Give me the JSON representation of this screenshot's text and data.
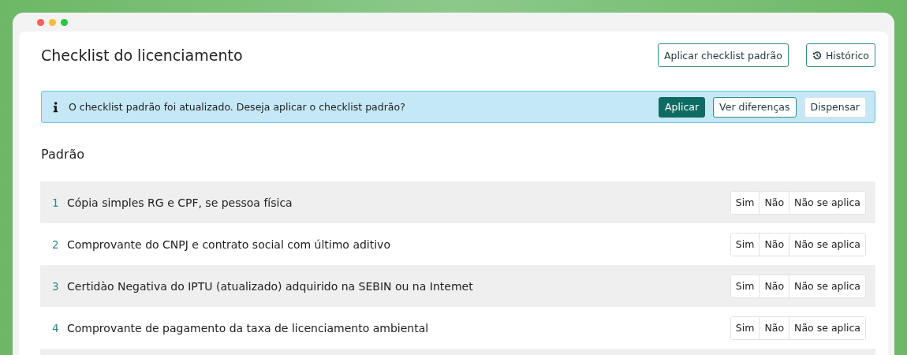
{
  "page": {
    "title": "Checklist do licenciamento",
    "actions": [
      {
        "label": "Aplicar checklist padrão",
        "kind": "text"
      },
      {
        "label": "Histórico",
        "kind": "history"
      }
    ]
  },
  "alert": {
    "message": "O checklist padrão foi atualizado. Deseja aplicar o checklist padrão?",
    "buttons": [
      {
        "label": "Aplicar",
        "kind": "primary"
      },
      {
        "label": "Ver diferenças",
        "kind": "outline"
      },
      {
        "label": "Dispensar",
        "kind": "plain"
      }
    ]
  },
  "section": {
    "title": "Padrão",
    "items": [
      {
        "number": "1",
        "text": "Cópia simples RG e CPF, se pessoa física",
        "options": [
          {
            "label": "Sim",
            "selected": false
          },
          {
            "label": "Não",
            "selected": false
          },
          {
            "label": "Não se aplica",
            "selected": false
          }
        ]
      },
      {
        "number": "2",
        "text": "Comprovante do CNPJ e contrato social com último aditivo",
        "options": [
          {
            "label": "Sim",
            "selected": false
          },
          {
            "label": "Não",
            "selected": false
          },
          {
            "label": "Não se aplica",
            "selected": false
          }
        ]
      },
      {
        "number": "3",
        "text": "Certidào Negativa do IPTU (atualizado) adquirido na SEBIN ou na Intemet",
        "options": [
          {
            "label": "Sim",
            "selected": false
          },
          {
            "label": "Não",
            "selected": false
          },
          {
            "label": "Não se aplica",
            "selected": false
          }
        ]
      },
      {
        "number": "4",
        "text": "Comprovante de pagamento da taxa de licenciamento ambiental",
        "options": [
          {
            "label": "Sim",
            "selected": false
          },
          {
            "label": "Não",
            "selected": false
          },
          {
            "label": "Não se aplica",
            "selected": false
          }
        ]
      }
    ]
  }
}
